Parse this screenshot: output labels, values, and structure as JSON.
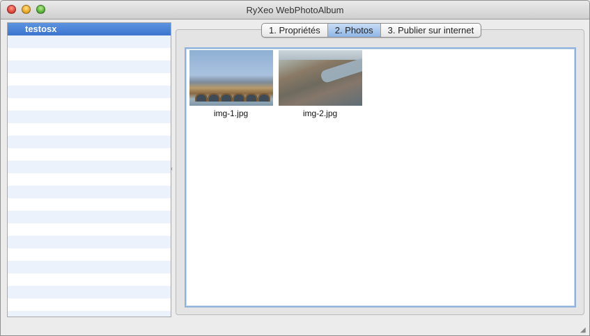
{
  "window": {
    "title": "RyXeo WebPhotoAlbum"
  },
  "sidebar": {
    "items": [
      {
        "label": "testosx",
        "selected": true
      }
    ]
  },
  "tabs": [
    {
      "label": "1. Propriétés",
      "active": false
    },
    {
      "label": "2. Photos",
      "active": true
    },
    {
      "label": "3. Publier sur internet",
      "active": false
    }
  ],
  "photos": [
    {
      "filename": "img-1.jpg"
    },
    {
      "filename": "img-2.jpg"
    }
  ],
  "colors": {
    "selection": "#3b74cf",
    "active_tab": "#8fb6e6",
    "focus_ring": "#8fb2dc"
  }
}
